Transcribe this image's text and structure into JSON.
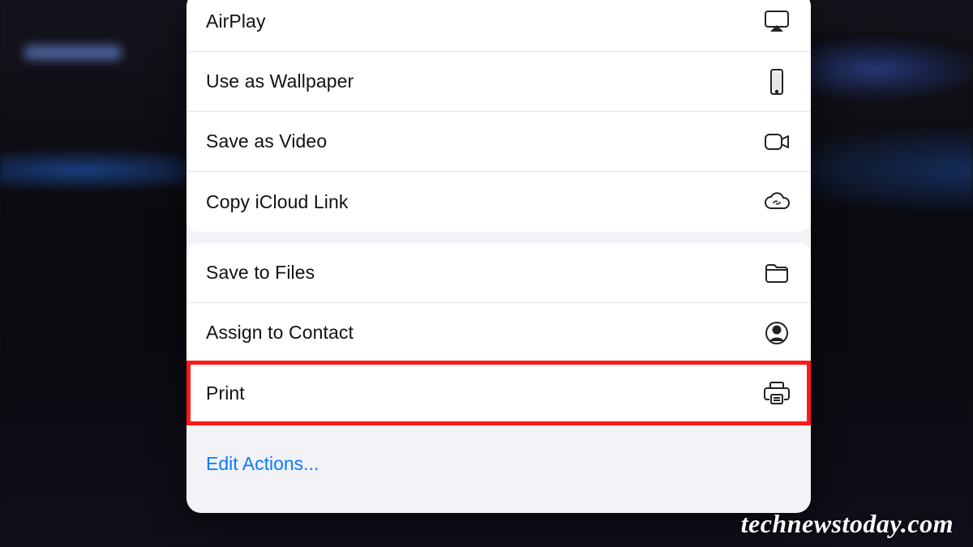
{
  "groups": [
    {
      "items": [
        {
          "label": "AirPlay",
          "icon": "airplay-icon"
        },
        {
          "label": "Use as Wallpaper",
          "icon": "phone-icon"
        },
        {
          "label": "Save as Video",
          "icon": "video-icon"
        },
        {
          "label": "Copy iCloud Link",
          "icon": "cloud-link-icon"
        }
      ]
    },
    {
      "items": [
        {
          "label": "Save to Files",
          "icon": "folder-icon"
        },
        {
          "label": "Assign to Contact",
          "icon": "contact-icon"
        },
        {
          "label": "Print",
          "icon": "printer-icon",
          "highlighted": true
        }
      ]
    }
  ],
  "footer": {
    "edit_label": "Edit Actions..."
  },
  "watermark": "technewstoday.com",
  "colors": {
    "link": "#0a7aff",
    "highlight": "#ff1a1a",
    "sheet_bg": "#f2f2f7"
  }
}
